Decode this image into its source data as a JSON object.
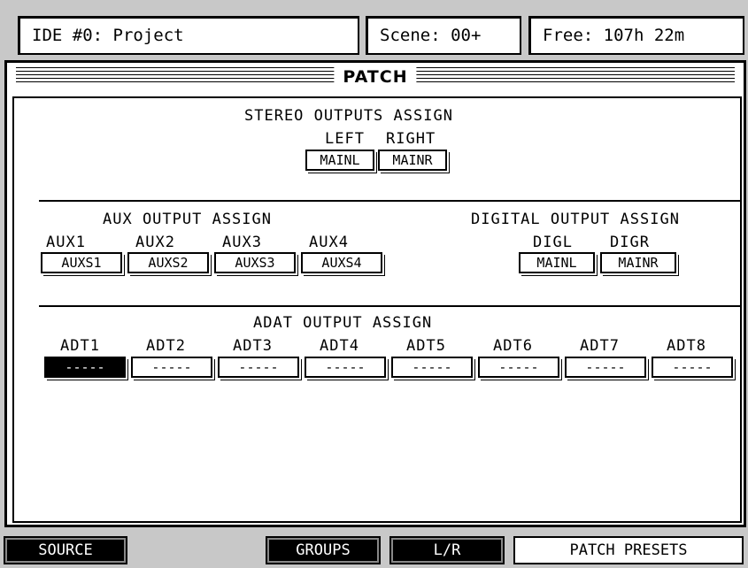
{
  "header": {
    "project": "IDE #0: Project",
    "scene": "Scene: 00+",
    "free": "Free: 107h 22m"
  },
  "panel": {
    "title": "PATCH"
  },
  "stereo": {
    "heading": "STEREO OUTPUTS ASSIGN",
    "left_label": "LEFT",
    "right_label": "RIGHT",
    "left_value": "MAINL",
    "right_value": "MAINR"
  },
  "aux": {
    "heading": "AUX OUTPUT ASSIGN",
    "labels": [
      "AUX1",
      "AUX2",
      "AUX3",
      "AUX4"
    ],
    "values": [
      "AUXS1",
      "AUXS2",
      "AUXS3",
      "AUXS4"
    ]
  },
  "digital": {
    "heading": "DIGITAL OUTPUT ASSIGN",
    "labels": [
      "DIGL",
      "DIGR"
    ],
    "values": [
      "MAINL",
      "MAINR"
    ]
  },
  "adat": {
    "heading": "ADAT OUTPUT ASSIGN",
    "labels": [
      "ADT1",
      "ADT2",
      "ADT3",
      "ADT4",
      "ADT5",
      "ADT6",
      "ADT7",
      "ADT8"
    ],
    "values": [
      "-----",
      "-----",
      "-----",
      "-----",
      "-----",
      "-----",
      "-----",
      "-----"
    ]
  },
  "buttons": {
    "source": "SOURCE",
    "groups": "GROUPS",
    "lr": "L/R",
    "patch_presets": "PATCH PRESETS"
  }
}
